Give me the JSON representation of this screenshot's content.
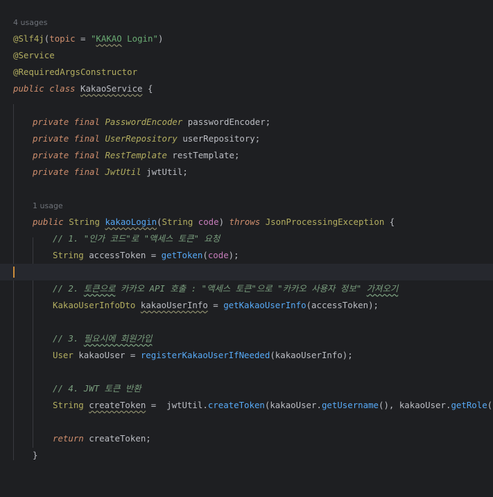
{
  "editor": {
    "class_usages": "4 usages",
    "method_usages": "1 usage",
    "ann_slf4j": "@Slf4j",
    "ann_slf4j_open": "(",
    "ann_slf4j_topic": "topic",
    "ann_slf4j_eq": " = ",
    "ann_slf4j_value_q1": "\"",
    "ann_slf4j_value_kakao": "KAKAO",
    "ann_slf4j_value_rest": " Login\"",
    "ann_slf4j_close": ")",
    "ann_service": "@Service",
    "ann_rac": "@RequiredArgsConstructor",
    "class_kw": "public class ",
    "class_name": "KakaoService",
    "class_open": " {",
    "private_final": "private final ",
    "fields": [
      {
        "type": "PasswordEncoder",
        "name": " passwordEncoder;"
      },
      {
        "type": "UserRepository",
        "name": " userRepository;"
      },
      {
        "type": "RestTemplate",
        "name": " restTemplate;"
      },
      {
        "type": "JwtUtil",
        "name": " jwtUtil;"
      }
    ],
    "method_public": "public ",
    "method_ret": "String ",
    "method_name": "kakaoLogin",
    "method_paren_open": "(",
    "method_param_type": "String ",
    "method_param": "code",
    "method_paren_close": ") ",
    "method_throws": "throws ",
    "method_exc": "JsonProcessingException",
    "method_brace": " {",
    "c1": "// 1. \"인가 코드\"로 \"액세스 토큰\" 요청",
    "l1_type": "String ",
    "l1_var": "accessToken = ",
    "l1_call": "getToken",
    "l1_open": "(",
    "l1_param": "code",
    "l1_close": ");",
    "c2_pre": "// 2. ",
    "c2_sq": "토큰으로",
    "c2_mid": " 카카오 API 호출 : \"액세스 토큰\"으로 \"카카오 사용자 정보\" ",
    "c2_sq2": "가져오기",
    "l2_type": "KakaoUserInfoDto ",
    "l2_var": "kakaoUserInfo",
    "l2_eq": " = ",
    "l2_call": "getKakaoUserInfo",
    "l2_args": "(accessToken);",
    "c3_pre": "// 3. ",
    "c3_sq": "필요시에 회원가입",
    "l3_type": "User ",
    "l3_var": "kakaoUser = ",
    "l3_call": "registerKakaoUserIfNeeded",
    "l3_args": "(kakaoUserInfo);",
    "c4": "// 4. JWT 토큰 반환",
    "l4_type": "String ",
    "l4_var": "createToken",
    "l4_eq": " =  jwtUtil.",
    "l4_call": "createToken",
    "l4_a1": "(kakaoUser.",
    "l4_call2": "getUsername",
    "l4_a2": "(), kakaoUser.",
    "l4_call3": "getRole",
    "l4_a3": "());",
    "ret_kw": "return ",
    "ret_val": "createToken;",
    "close_brace": "}"
  }
}
